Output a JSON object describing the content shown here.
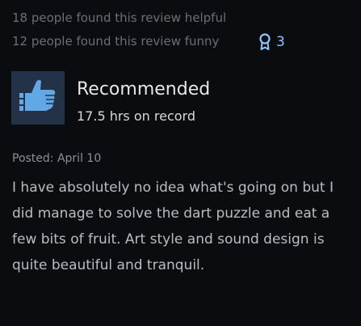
{
  "review": {
    "helpful_text": "18 people found this review helpful",
    "funny_text": "12 people found this review funny",
    "award_count": "3",
    "award_icon": "award-ribbon-icon",
    "verdict": "Recommended",
    "hours": "17.5 hrs on record",
    "posted": "Posted: April 10",
    "body": "I have absolutely no idea what's going on but I did manage to solve the dart puzzle and eat a few bits of fruit. Art style and sound design is quite beautiful and tranquil."
  },
  "colors": {
    "background": "#0b0c10",
    "thumb_box": "#233246",
    "thumb_icon": "#62a8e6",
    "award_accent": "#8ec4ff"
  }
}
